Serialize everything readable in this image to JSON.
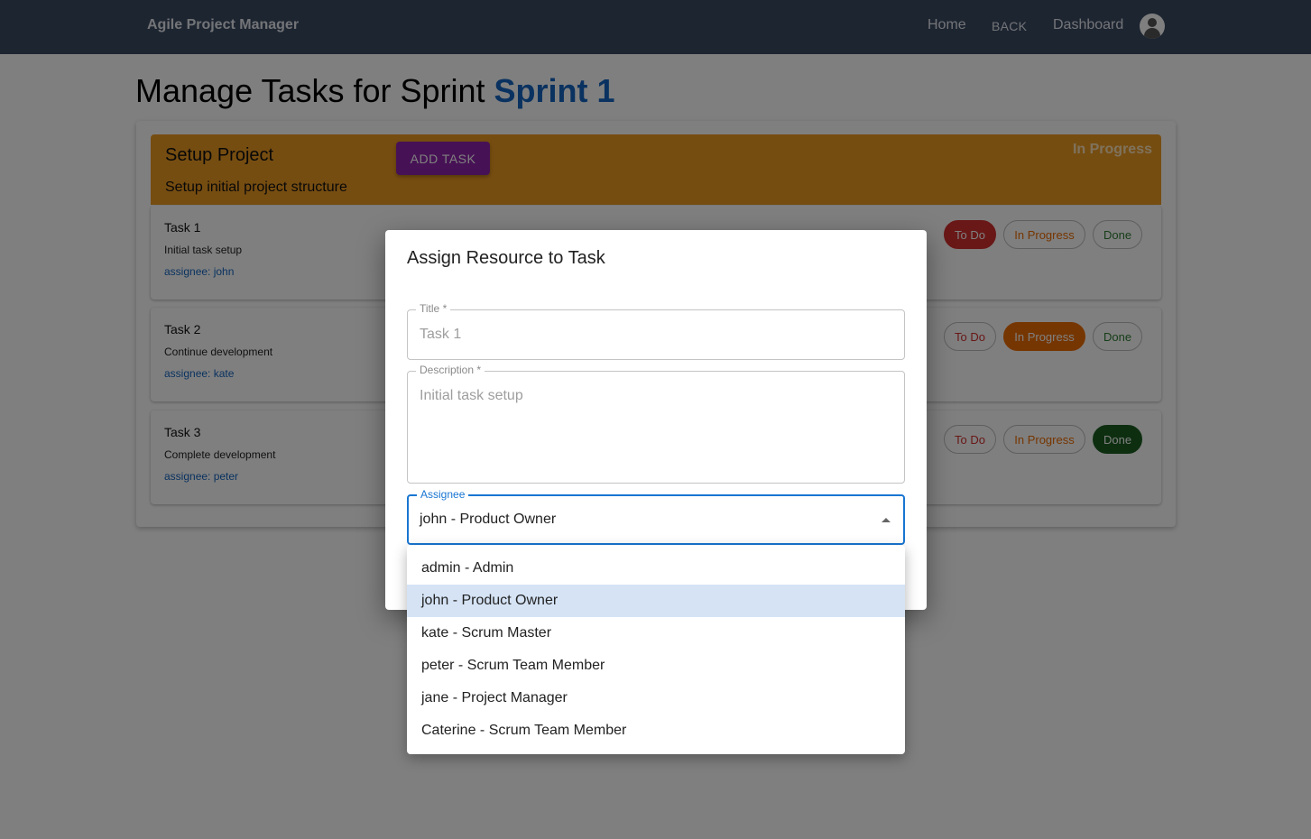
{
  "navbar": {
    "brand": "Agile Project Manager",
    "links": {
      "home": "Home",
      "back": "BACK",
      "dashboard": "Dashboard"
    }
  },
  "page": {
    "title_prefix": "Manage Tasks for Sprint",
    "sprint_name": "Sprint 1"
  },
  "story": {
    "title": "Setup Project",
    "description": "Setup initial project structure",
    "add_task_label": "ADD TASK",
    "status": "In Progress",
    "color": "#ed9a22"
  },
  "tasks": [
    {
      "title": "Task 1",
      "description": "Initial task setup",
      "assignee": "assignee: john",
      "status": "To Do"
    },
    {
      "title": "Task 2",
      "description": "Continue development",
      "assignee": "assignee: kate",
      "status": "In Progress"
    },
    {
      "title": "Task 3",
      "description": "Complete development",
      "assignee": "assignee: peter",
      "status": "Done"
    }
  ],
  "status_chips": {
    "todo": "To Do",
    "in_progress": "In Progress",
    "done": "Done"
  },
  "dialog": {
    "title": "Assign Resource to Task",
    "fields": {
      "title_label": "Title",
      "title_value": "Task 1",
      "description_label": "Description",
      "description_value": "Initial task setup",
      "assignee_label": "Assignee",
      "assignee_value": "john - Product Owner"
    },
    "assignee_options": [
      "admin - Admin",
      "john - Product Owner",
      "kate - Scrum Master",
      "peter - Scrum Team Member",
      "jane - Project Manager",
      "Caterine - Scrum Team Member"
    ],
    "selected_option": "john - Product Owner"
  },
  "colors": {
    "navbar": "#3b4a63",
    "accent": "#1565c0",
    "add_button": "#8e24aa",
    "todo": "#d32f2f",
    "in_progress": "#ed6c02",
    "done": "#1b5e20"
  }
}
